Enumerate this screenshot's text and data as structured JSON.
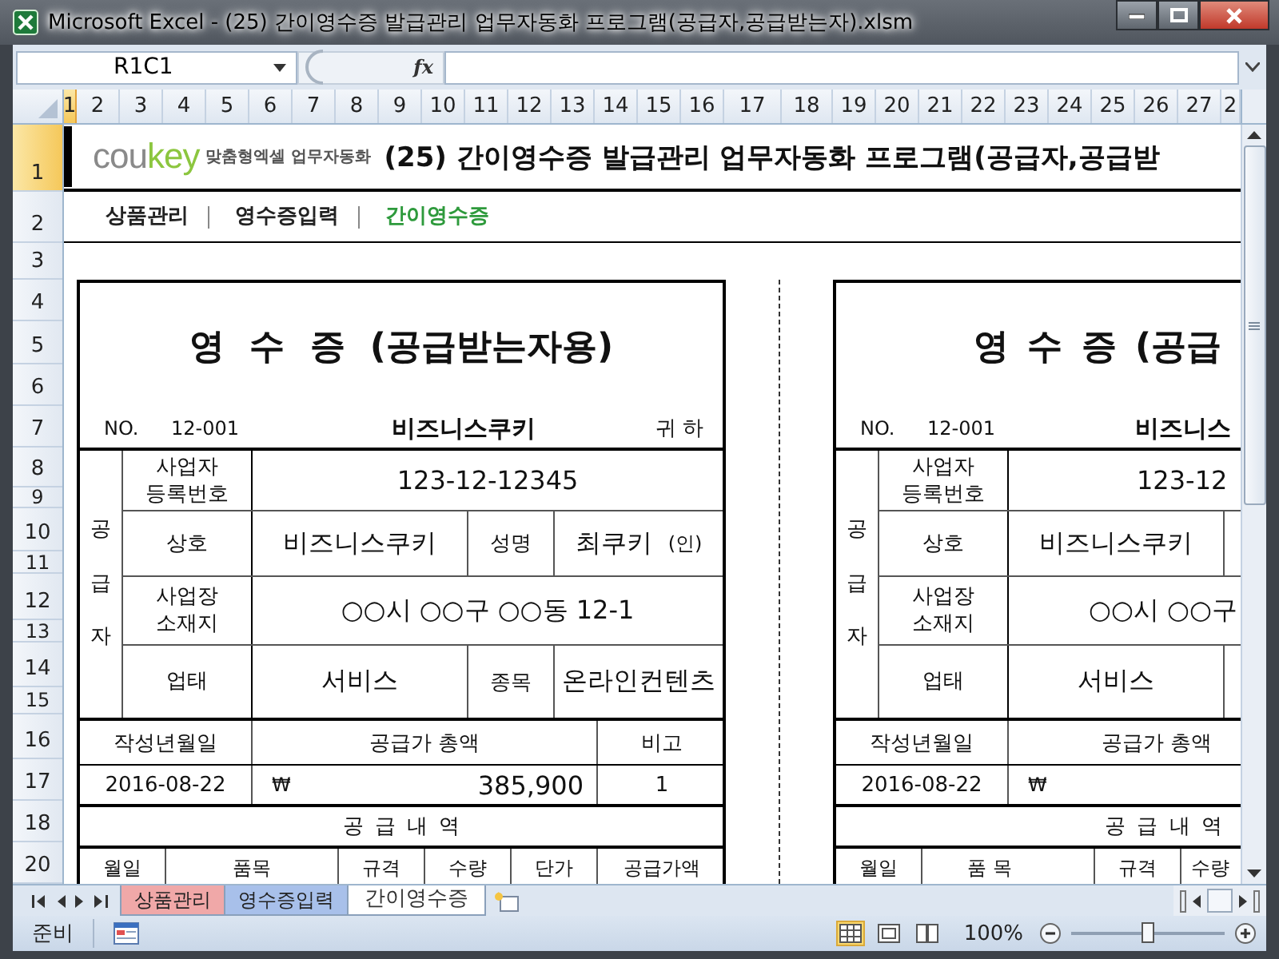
{
  "window": {
    "title": "Microsoft Excel - (25) 간이영수증 발급관리 업무자동화 프로그램(공급자,공급받는자).xlsm"
  },
  "formula_bar": {
    "name_box": "R1C1",
    "function_label": "fx"
  },
  "columns": [
    {
      "label": "1",
      "selected": true
    },
    {
      "label": "2",
      "selected": false
    },
    {
      "label": "3",
      "selected": false
    },
    {
      "label": "4",
      "selected": false
    },
    {
      "label": "5",
      "selected": false
    },
    {
      "label": "6",
      "selected": false
    },
    {
      "label": "7",
      "selected": false
    },
    {
      "label": "8",
      "selected": false
    },
    {
      "label": "9",
      "selected": false
    },
    {
      "label": "10",
      "selected": false
    },
    {
      "label": "11",
      "selected": false
    },
    {
      "label": "12",
      "selected": false
    },
    {
      "label": "13",
      "selected": false
    },
    {
      "label": "14",
      "selected": false
    },
    {
      "label": "15",
      "selected": false
    },
    {
      "label": "16",
      "selected": false
    },
    {
      "label": "17",
      "selected": false
    },
    {
      "label": "18",
      "selected": false
    },
    {
      "label": "19",
      "selected": false
    },
    {
      "label": "20",
      "selected": false
    },
    {
      "label": "21",
      "selected": false
    },
    {
      "label": "22",
      "selected": false
    },
    {
      "label": "23",
      "selected": false
    },
    {
      "label": "24",
      "selected": false
    },
    {
      "label": "25",
      "selected": false
    },
    {
      "label": "26",
      "selected": false
    },
    {
      "label": "27",
      "selected": false
    },
    {
      "label": "2",
      "selected": false
    }
  ],
  "rows": [
    {
      "label": "1",
      "selected": true
    },
    {
      "label": "2",
      "selected": false
    },
    {
      "label": "3",
      "selected": false
    },
    {
      "label": "4",
      "selected": false
    },
    {
      "label": "5",
      "selected": false
    },
    {
      "label": "6",
      "selected": false
    },
    {
      "label": "7",
      "selected": false
    },
    {
      "label": "8",
      "selected": false
    },
    {
      "label": "9",
      "selected": false
    },
    {
      "label": "10",
      "selected": false
    },
    {
      "label": "11",
      "selected": false
    },
    {
      "label": "12",
      "selected": false
    },
    {
      "label": "13",
      "selected": false
    },
    {
      "label": "14",
      "selected": false
    },
    {
      "label": "15",
      "selected": false
    },
    {
      "label": "16",
      "selected": false
    },
    {
      "label": "17",
      "selected": false
    },
    {
      "label": "18",
      "selected": false
    },
    {
      "label": "20",
      "selected": false
    }
  ],
  "header": {
    "logo": [
      "cou",
      "key"
    ],
    "tagline": "맞춤형엑셀 업무자동화",
    "title": "(25) 간이영수증 발급관리 업무자동화 프로그램(공급자,공급받"
  },
  "nav": [
    {
      "label": "상품관리",
      "selected": false
    },
    {
      "label": "영수증입력",
      "selected": false
    },
    {
      "label": "간이영수증",
      "selected": true
    }
  ],
  "receipts": [
    {
      "title": "영 수 증 (공급받는자용)",
      "no_label": "NO.",
      "no": "12-001",
      "customer": "비즈니스쿠키",
      "honorific": "귀 하",
      "supplier_label": "공급자",
      "fields": [
        {
          "kind": "single",
          "label": "사업자 등록번호",
          "value": "123-12-12345"
        },
        {
          "kind": "split",
          "label": "상호",
          "value": "비즈니스쿠키",
          "label2": "성명",
          "value2": "최쿠키",
          "seal": "(인)"
        },
        {
          "kind": "single",
          "label": "사업장 소재지",
          "value": "○○시 ○○구 ○○동 12-1"
        },
        {
          "kind": "split",
          "label": "업태",
          "value": "서비스",
          "label2": "종목",
          "value2": "온라인컨텐츠"
        }
      ],
      "summary_headers": [
        "작성년월일",
        "공급가 총액",
        "비고"
      ],
      "date": "2016-08-22",
      "currency": "₩",
      "total": "385,900",
      "note": "1",
      "detail_title": "공 급 내 역",
      "detail_columns": [
        "월일",
        "품목",
        "규격",
        "수량",
        "단가",
        "공급가액"
      ]
    },
    {
      "title": "영 수 증 (공급",
      "no_label": "NO.",
      "no": "12-001",
      "customer": "비즈니스",
      "supplier_label": "공급자",
      "fields": [
        {
          "kind": "single",
          "label": "사업자 등록번호",
          "value": "123-12"
        },
        {
          "kind": "split",
          "label": "상호",
          "value": "비즈니스쿠키"
        },
        {
          "kind": "single",
          "label": "사업장 소재지",
          "value": "○○시 ○○구"
        },
        {
          "kind": "split",
          "label": "업태",
          "value": "서비스"
        }
      ],
      "summary_headers": [
        "작성년월일",
        "공급가 총액"
      ],
      "date": "2016-08-22",
      "currency": "₩",
      "detail_title": "공 급 내 역",
      "detail_columns": [
        "월일",
        "품 목",
        "규격",
        "수량"
      ]
    }
  ],
  "sheet_tabs": [
    {
      "label": "상품관리",
      "selected": false,
      "color": "#f0a8a8"
    },
    {
      "label": "영수증입력",
      "selected": false,
      "color": "#a8c0ea"
    },
    {
      "label": "간이영수증",
      "selected": true
    }
  ],
  "status_bar": {
    "text": "준비",
    "views": [
      {
        "kind": "normal",
        "selected": true
      },
      {
        "kind": "page_layout",
        "selected": false
      },
      {
        "kind": "page_break",
        "selected": false
      }
    ],
    "zoom": "100%",
    "zoom_slider": {
      "level": 0.5
    }
  }
}
